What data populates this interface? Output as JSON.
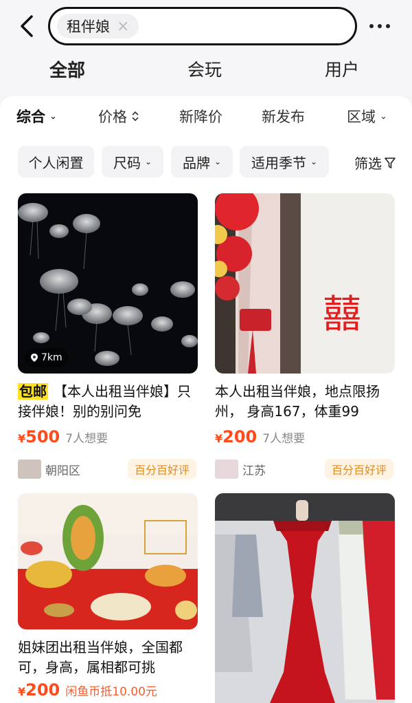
{
  "search": {
    "query": "租伴娘"
  },
  "tabs": [
    {
      "label": "全部",
      "active": true
    },
    {
      "label": "会玩",
      "active": false
    },
    {
      "label": "用户",
      "active": false
    }
  ],
  "sort": [
    {
      "label": "综合",
      "icon": "chevron-down-icon",
      "active": true
    },
    {
      "label": "价格",
      "icon": "sort-updown-icon",
      "active": false
    },
    {
      "label": "新降价",
      "active": false
    },
    {
      "label": "新发布",
      "active": false
    },
    {
      "label": "区域",
      "icon": "chevron-down-icon",
      "active": false
    }
  ],
  "filters": [
    {
      "label": "个人闲置"
    },
    {
      "label": "尺码",
      "icon": "chevron-down-icon"
    },
    {
      "label": "品牌",
      "icon": "chevron-down-icon"
    },
    {
      "label": "适用季节",
      "icon": "chevron-down-icon"
    }
  ],
  "screen_label": "筛选",
  "colors": {
    "accent_yellow": "#ffe226",
    "price_red": "#ff4a1c",
    "badge_orange": "#e08a1e"
  },
  "items": [
    {
      "tag": "包邮",
      "title": "【本人出租当伴娘】只接伴娘！别的别问免",
      "currency": "¥",
      "price": "500",
      "want": "7人想要",
      "location": "朝阳区",
      "badge": "百分百好评",
      "distance": "7km",
      "image": "jellyfish-photo"
    },
    {
      "title": "本人出租当伴娘，地点限扬州， 身高167，体重99",
      "currency": "¥",
      "price": "200",
      "want": "7人想要",
      "location": "江苏",
      "badge": "百分百好评",
      "image": "wedding-door-photo"
    },
    {
      "title": "姐妹团出租当伴娘，全国都可，身高，属相都可挑",
      "currency": "¥",
      "price": "200",
      "coin": "闲鱼币抵10.00元",
      "image": "fruit-carving-photo"
    },
    {
      "image": "red-dress-photo"
    }
  ]
}
